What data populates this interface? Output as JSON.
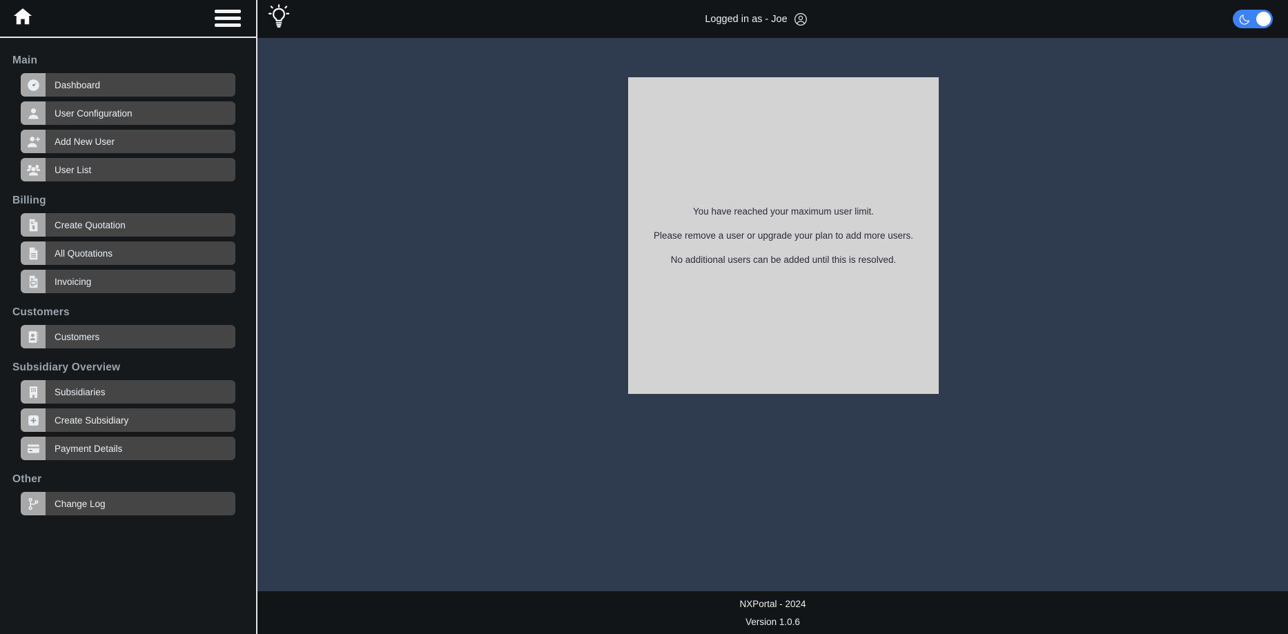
{
  "header": {
    "home_icon": "home-icon",
    "menu_icon": "hamburger-menu-icon",
    "bulb_icon": "lightbulb-icon",
    "logged_in_text": "Logged in as - Joe",
    "avatar_icon": "user-avatar-icon",
    "theme_toggle_icon": "moon-icon",
    "accent_color": "#3c82f6"
  },
  "sidebar": {
    "groups": [
      {
        "title": "Main",
        "items": [
          {
            "label": "Dashboard",
            "icon": "speedometer-icon"
          },
          {
            "label": "User Configuration",
            "icon": "user-icon"
          },
          {
            "label": "Add New User",
            "icon": "user-plus-icon"
          },
          {
            "label": "User List",
            "icon": "users-group-icon"
          }
        ]
      },
      {
        "title": "Billing",
        "items": [
          {
            "label": "Create Quotation",
            "icon": "document-dollar-icon"
          },
          {
            "label": "All Quotations",
            "icon": "document-lines-icon"
          },
          {
            "label": "Invoicing",
            "icon": "invoice-icon"
          }
        ]
      },
      {
        "title": "Customers",
        "items": [
          {
            "label": "Customers",
            "icon": "contact-book-icon"
          }
        ]
      },
      {
        "title": "Subsidiary Overview",
        "items": [
          {
            "label": "Subsidiaries",
            "icon": "building-icon"
          },
          {
            "label": "Create Subsidiary",
            "icon": "plus-square-icon"
          },
          {
            "label": "Payment Details",
            "icon": "credit-card-icon"
          }
        ]
      },
      {
        "title": "Other",
        "items": [
          {
            "label": "Change Log",
            "icon": "git-branch-icon"
          }
        ]
      }
    ]
  },
  "main": {
    "panel_background": "#d3d3d3",
    "messages": [
      "You have reached your maximum user limit.",
      "Please remove a user or upgrade your plan to add more users.",
      "No additional users can be added until this is resolved."
    ]
  },
  "footer": {
    "copyright": "NXPortal - 2024",
    "version": "Version 1.0.6"
  }
}
